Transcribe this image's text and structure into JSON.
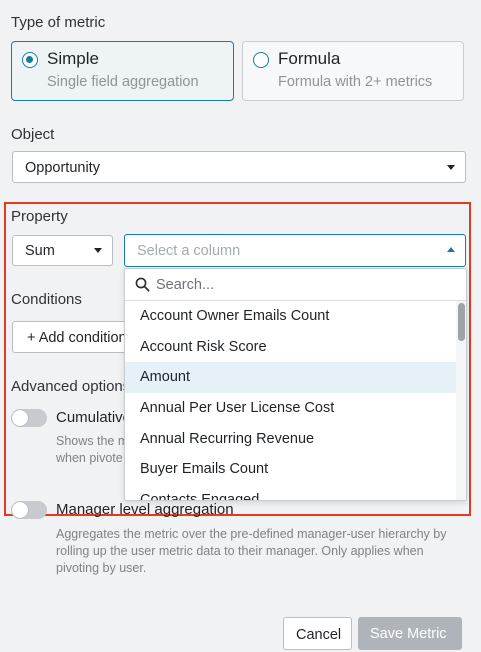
{
  "type_of_metric": {
    "label": "Type of metric",
    "options": [
      {
        "title": "Simple",
        "subtitle": "Single field aggregation",
        "selected": true
      },
      {
        "title": "Formula",
        "subtitle": "Formula with 2+ metrics",
        "selected": false
      }
    ]
  },
  "object": {
    "label": "Object",
    "value": "Opportunity"
  },
  "property": {
    "label": "Property",
    "aggregation": "Sum",
    "column_placeholder": "Select a column"
  },
  "conditions": {
    "label": "Conditions",
    "add_button": "+ Add condition"
  },
  "advanced": {
    "label": "Advanced options",
    "cumulative": {
      "label": "Cumulative",
      "help_line1": "Shows the m",
      "help_line2": "when pivote"
    },
    "manager": {
      "label": "Manager level aggregation",
      "help": "Aggregates the metric over the pre-defined manager-user hierarchy by rolling up the user metric data to their manager. Only applies when pivoting by user."
    }
  },
  "dropdown": {
    "search_placeholder": "Search...",
    "items": [
      "Account Owner Emails Count",
      "Account Risk Score",
      "Amount",
      "Annual Per User License Cost",
      "Annual Recurring Revenue",
      "Buyer Emails Count",
      "Contacts Engaged"
    ],
    "highlighted_item": "Amount"
  },
  "footer": {
    "cancel": "Cancel",
    "save": "Save Metric"
  },
  "colors": {
    "accent": "#1b79a6",
    "highlight_border": "#e23b24",
    "disabled_button": "#aeb4b9"
  },
  "icons": [
    "radio-selected-icon",
    "radio-unselected-icon",
    "chevron-down-icon",
    "chevron-up-icon",
    "search-icon"
  ]
}
